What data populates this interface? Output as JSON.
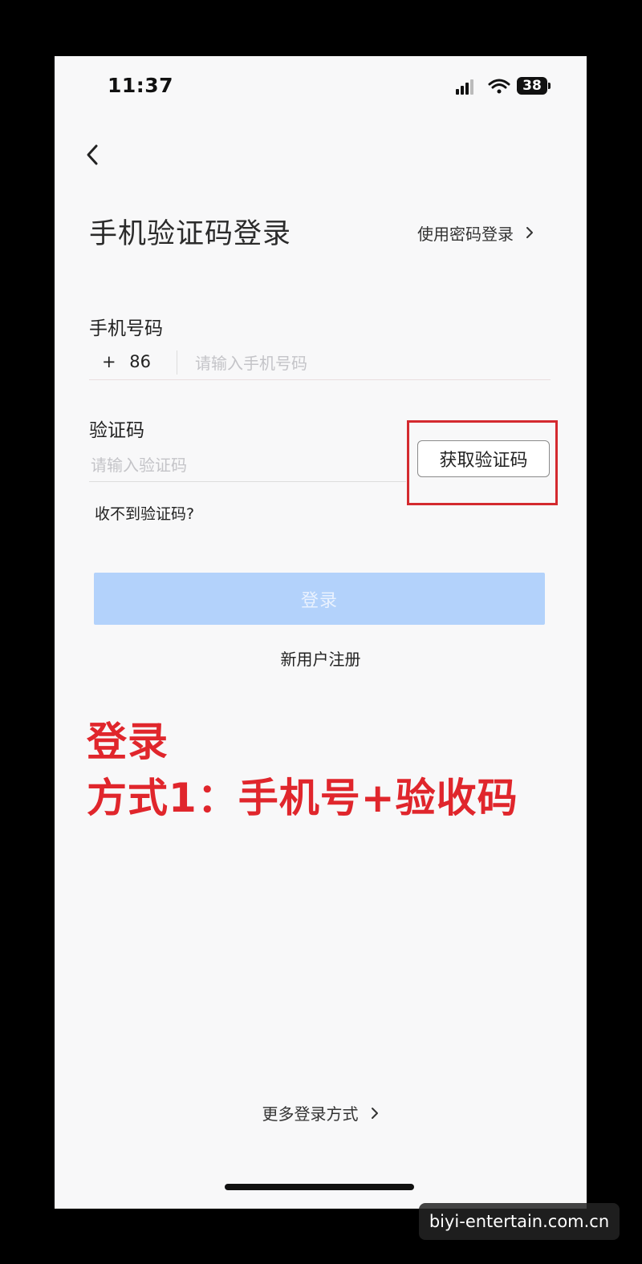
{
  "status_bar": {
    "time": "11:37",
    "battery": "38"
  },
  "header": {
    "title": "手机验证码登录",
    "password_login_link": "使用密码登录"
  },
  "phone_field": {
    "label": "手机号码",
    "country_code_plus": "+",
    "country_code": "86",
    "placeholder": "请输入手机号码",
    "value": ""
  },
  "code_field": {
    "label": "验证码",
    "placeholder": "请输入验证码",
    "value": "",
    "get_code_button": "获取验证码"
  },
  "no_code_link": "收不到验证码?",
  "login_button": "登录",
  "register_link": "新用户注册",
  "annotation": {
    "line1": "登录",
    "line2": "方式1：手机号+验收码"
  },
  "more_methods_link": "更多登录方式",
  "watermark": "biyi-entertain.com.cn",
  "colors": {
    "login_button_disabled": "#b3d2fb",
    "annotation_red": "#e0262c",
    "highlight_box": "#d42a2f"
  },
  "icons": {
    "back": "chevron-left-icon",
    "link_arrow": "chevron-right-icon",
    "signal": "signal-icon",
    "wifi": "wifi-icon",
    "battery": "battery-icon"
  }
}
